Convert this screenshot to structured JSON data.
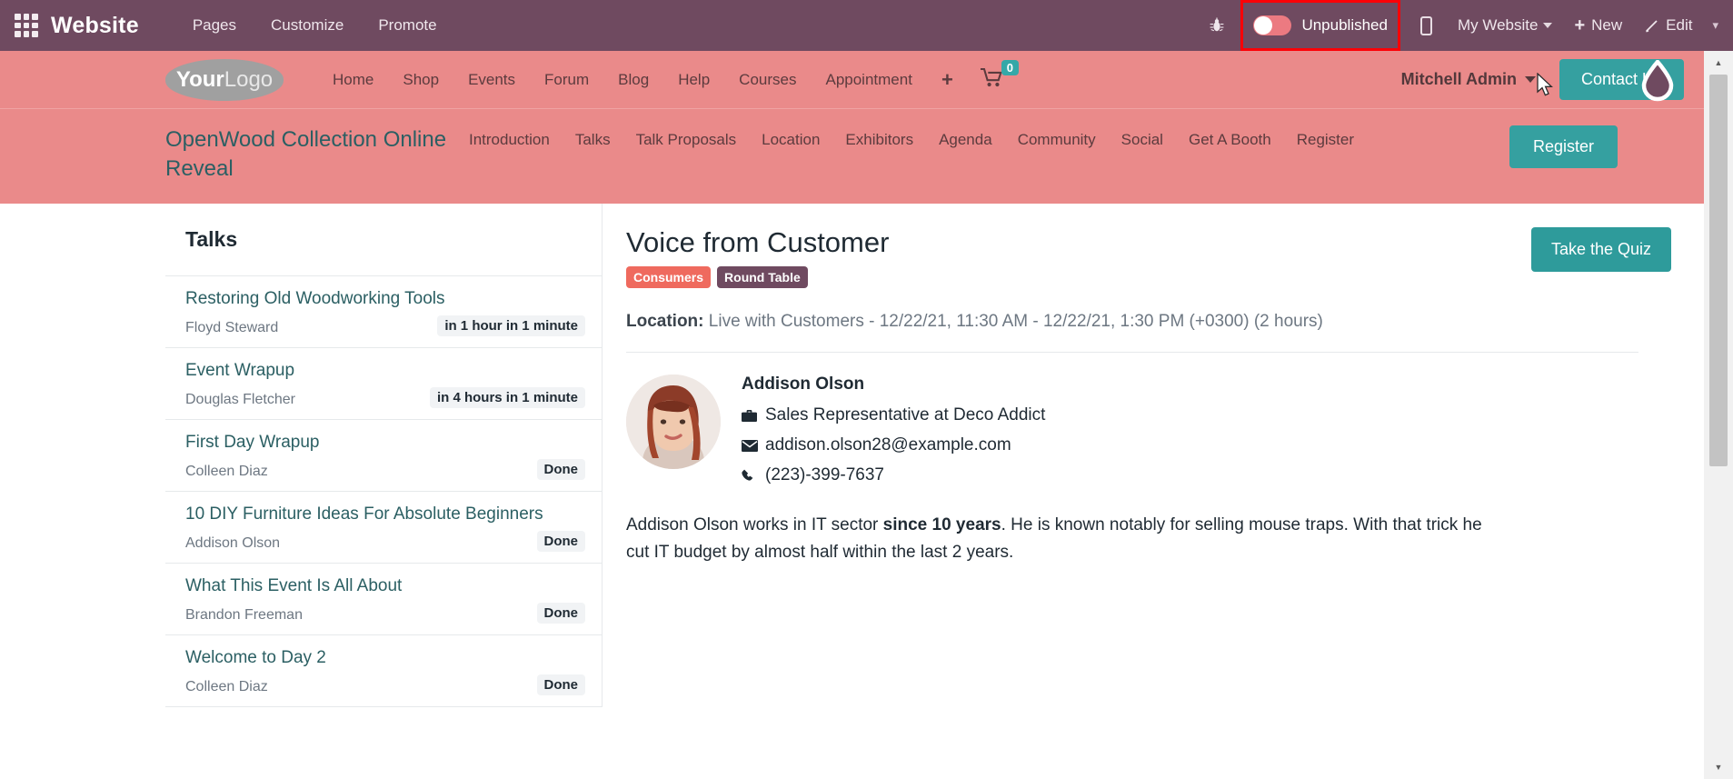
{
  "odoo_bar": {
    "app_title": "Website",
    "menus": [
      "Pages",
      "Customize",
      "Promote"
    ],
    "bug_icon": "bug-icon",
    "publish_label": "Unpublished",
    "publish_state": "off",
    "highlight_color": "#fb0007",
    "mobile_preview_icon": "mobile-preview-icon",
    "my_website": "My Website",
    "new_label": "New",
    "edit_label": "Edit",
    "more_caret": "▾"
  },
  "site_header": {
    "logo_bold": "Your",
    "logo_light": "Logo",
    "nav": [
      "Home",
      "Shop",
      "Events",
      "Forum",
      "Blog",
      "Help",
      "Courses",
      "Appointment"
    ],
    "plus_label": "+",
    "cart_count": "0",
    "user_name": "Mitchell Admin",
    "contact_label": "Contact Us",
    "theme_droplet": "theme-color-droplet-icon",
    "background_color": "#ea8a8a",
    "accent_color": "#35a0a0"
  },
  "event_header": {
    "title": "OpenWood Collection Online Reveal",
    "nav": [
      "Introduction",
      "Talks",
      "Talk Proposals",
      "Location",
      "Exhibitors",
      "Agenda",
      "Community",
      "Social",
      "Get A Booth",
      "Register"
    ],
    "register_label": "Register"
  },
  "talks_panel": {
    "heading": "Talks",
    "items": [
      {
        "name": "Restoring Old Woodworking Tools",
        "speaker": "Floyd Steward",
        "status": "in 1 hour in 1 minute"
      },
      {
        "name": "Event Wrapup",
        "speaker": "Douglas Fletcher",
        "status": "in 4 hours in 1 minute"
      },
      {
        "name": "First Day Wrapup",
        "speaker": "Colleen Diaz",
        "status": "Done"
      },
      {
        "name": "10 DIY Furniture Ideas For Absolute Beginners",
        "speaker": "Addison Olson",
        "status": "Done"
      },
      {
        "name": "What This Event Is All About",
        "speaker": "Brandon Freeman",
        "status": "Done"
      },
      {
        "name": "Welcome to Day 2",
        "speaker": "Colleen Diaz",
        "status": "Done"
      }
    ]
  },
  "talk_detail": {
    "title": "Voice from Customer",
    "badges": [
      {
        "label": "Consumers",
        "color": "#ef6a5e"
      },
      {
        "label": "Round Table",
        "color": "#6f4a60"
      }
    ],
    "quiz_button": "Take the Quiz",
    "location_label": "Location:",
    "location_value": "Live with Customers - 12/22/21, 11:30 AM - 12/22/21, 1:30 PM (+0300) (2 hours)",
    "speaker": {
      "name": "Addison Olson",
      "job": "Sales Representative at Deco Addict",
      "email": "addison.olson28@example.com",
      "phone": "(223)-399-7637",
      "avatar": "speaker-avatar-photo",
      "job_icon": "briefcase-icon",
      "email_icon": "envelope-icon",
      "phone_icon": "phone-icon"
    },
    "description_part1": "Addison Olson works in IT sector ",
    "description_bold": "since 10 years",
    "description_part2": ". He is known notably for selling mouse traps. With that trick he cut IT budget by almost half within the last 2 years."
  },
  "scrollbar": {
    "up": "▲",
    "down": "▼"
  }
}
